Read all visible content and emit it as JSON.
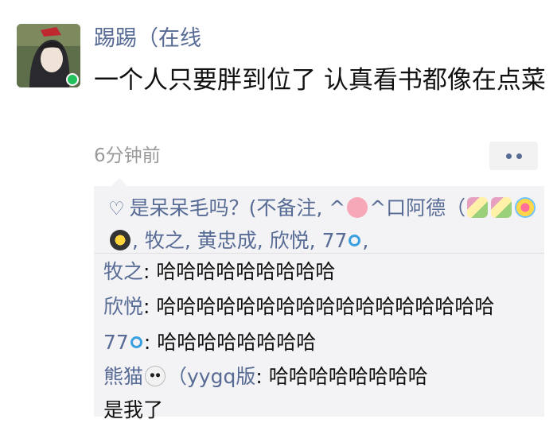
{
  "post": {
    "username": "踢踢（在线",
    "text": "一个人只要胖到位了 认真看书都像在点菜",
    "time": "6分钟前"
  },
  "likes": {
    "part1": "是呆呆毛吗？(不备注, ^",
    "part2": "^口阿德（",
    "part3": ", 牧之, 黄忠成, 欣悦, 77",
    "part4": ","
  },
  "comments": [
    {
      "name": "牧之",
      "sep": ": ",
      "text": "哈哈哈哈哈哈哈哈哈"
    },
    {
      "name": "欣悦",
      "sep": ": ",
      "text": "哈哈哈哈哈哈哈哈哈哈哈哈哈哈哈哈哈"
    },
    {
      "name": "77",
      "sep": ": ",
      "text": "哈哈哈哈哈哈哈哈"
    },
    {
      "name": "熊猫",
      "name2": "（yygq版",
      "sep": ": ",
      "text": "哈哈哈哈哈哈哈哈"
    },
    {
      "name": "",
      "sep": "",
      "text": "是我了"
    }
  ],
  "icons": {
    "heart": "heart-icon",
    "more": "more-icon",
    "pig": "pig-emoji",
    "panda": "panda-emoji",
    "ring": "ring-emoji"
  },
  "colors": {
    "link": "#576b95",
    "panel_bg": "#f3f3f5",
    "time": "#9a9a9a"
  }
}
